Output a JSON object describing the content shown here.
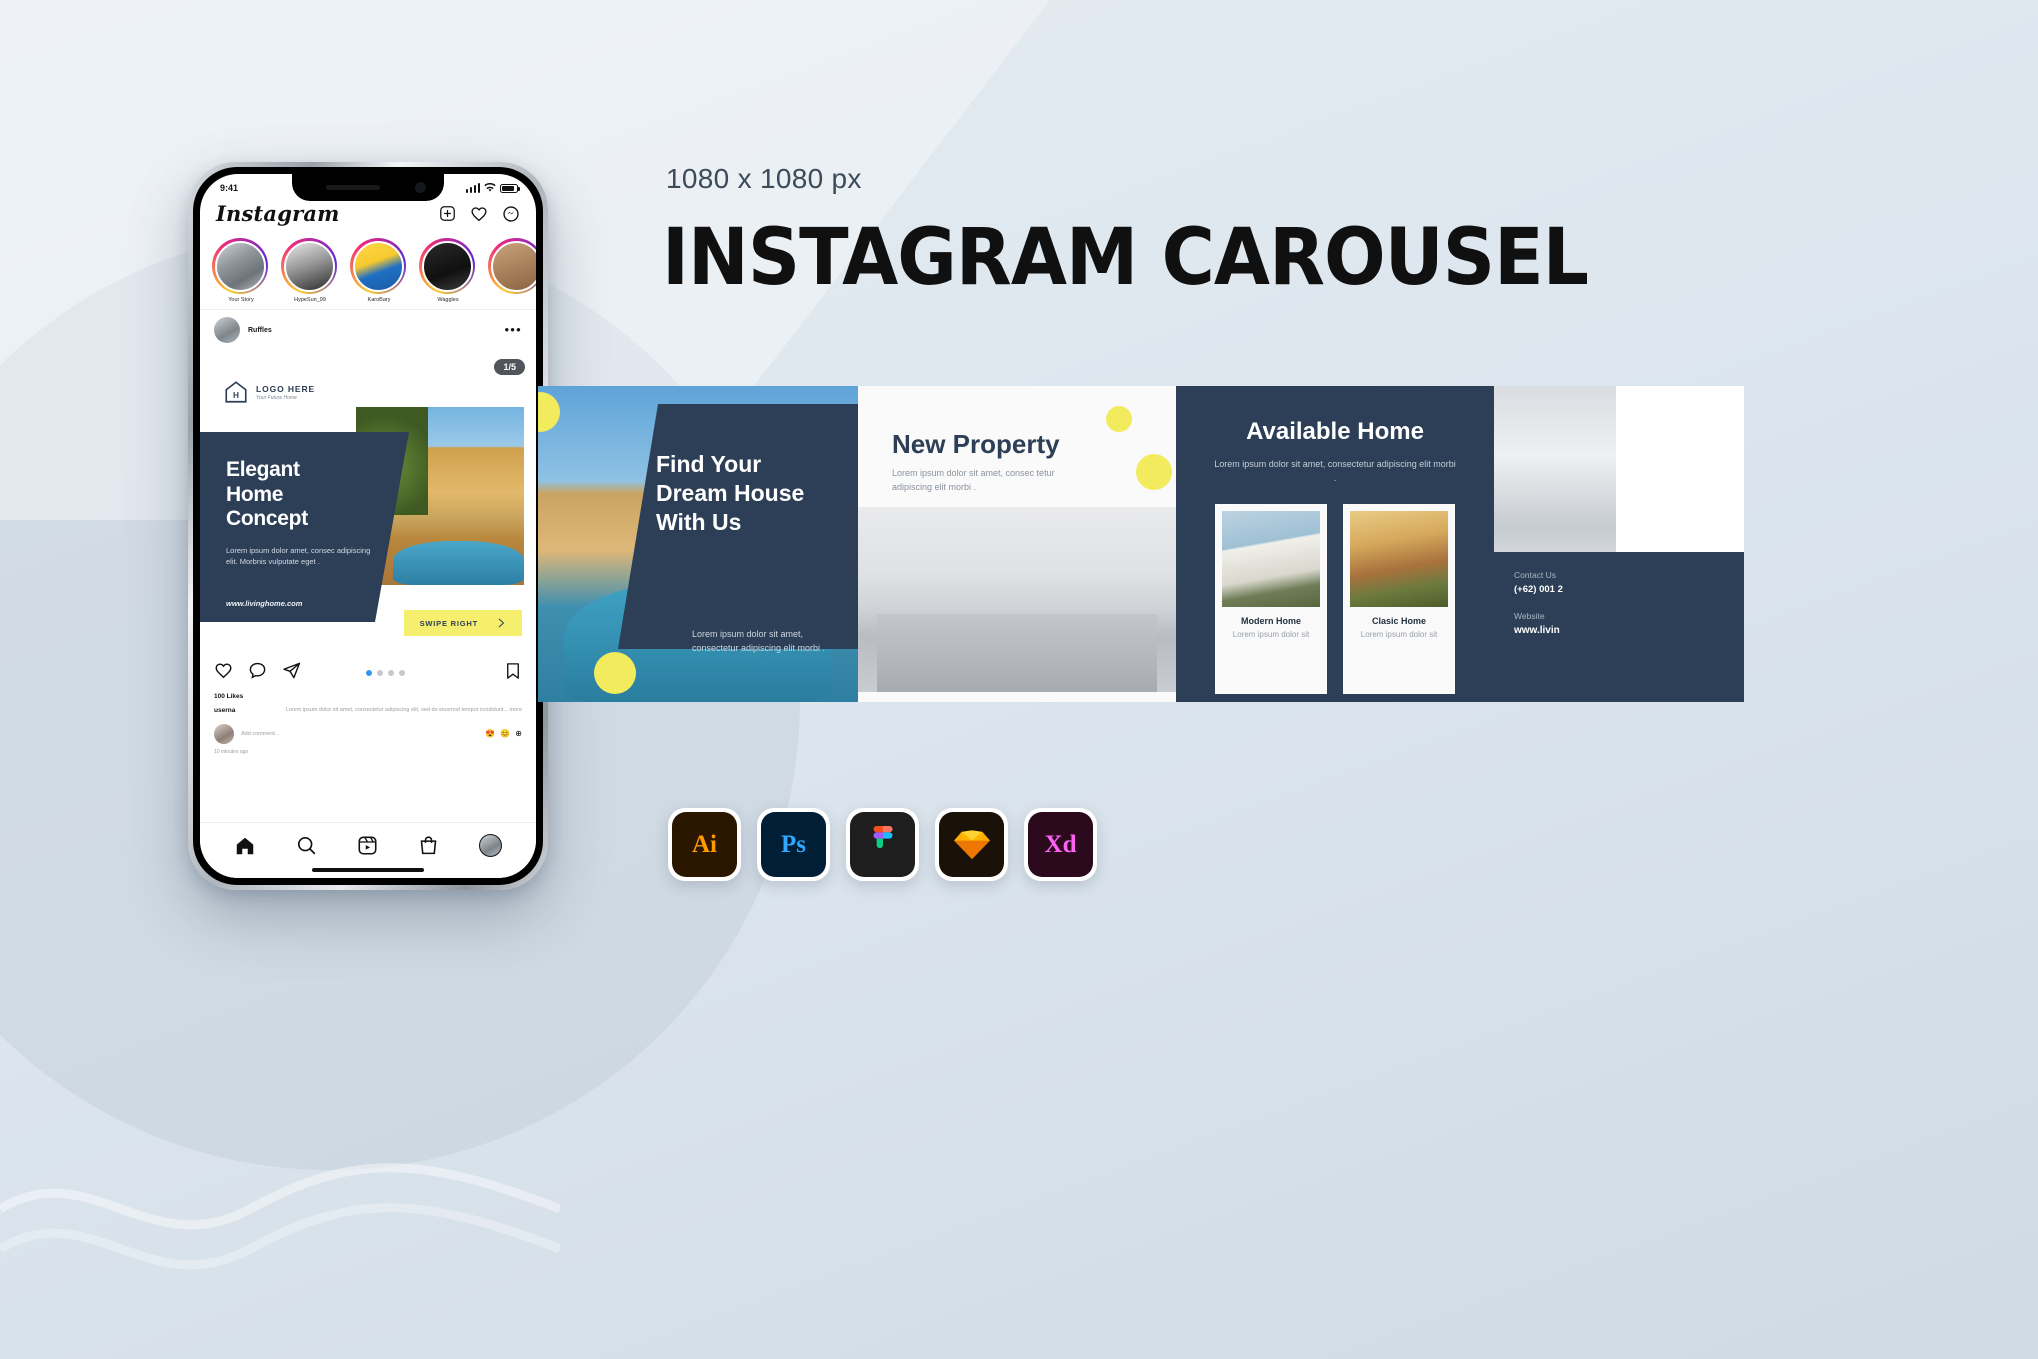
{
  "meta": {
    "dimensions_label": "1080 x 1080 px",
    "main_title": "INSTAGRAM CAROUSEL",
    "accent_navy": "#2c3f56",
    "accent_yellow": "#f3eb5e",
    "background": "#e5ecf2"
  },
  "phone": {
    "status": {
      "time": "9:41"
    },
    "app_name": "Instagram",
    "header_icons": [
      "add-post-icon",
      "heart-icon",
      "messenger-icon"
    ],
    "stories": [
      {
        "name": "Your Story"
      },
      {
        "name": "HypeSun_99"
      },
      {
        "name": "KaroBary"
      },
      {
        "name": "Waggles"
      },
      {
        "name": ""
      }
    ],
    "post": {
      "username": "Ruffles",
      "more_icon": "•••",
      "counter": "1/5",
      "logo_title": "LOGO HERE",
      "logo_sub": "Your Future Home",
      "headline": "Elegant\nHome\nConcept",
      "body": "Lorem ipsum dolor amet, consec adipiscing elit. Morbnis vulputate eget .",
      "url": "www.livinghome.com",
      "swipe_label": "SWIPE RIGHT",
      "likes": "100 Likes",
      "caption_user": "userna",
      "caption_text": "Lorem ipsum dolor sit amet, consectetur adipiscing elit, sed do eiusmod tempor incididunt...",
      "caption_more": " more",
      "add_comment_placeholder": "Add comment...",
      "timestamp": "10 minutes ago",
      "dots_total": 4,
      "dots_active": 1
    },
    "tabs": [
      "home-icon",
      "search-icon",
      "reels-icon",
      "shop-icon",
      "profile-avatar"
    ]
  },
  "carousel": {
    "slide_a": {
      "headline": "Find Your\nDream House\nWith Us",
      "body": "Lorem ipsum dolor sit amet, consectetur adipiscing elit morbi ."
    },
    "slide_b": {
      "headline": "New Property",
      "body": "Lorem ipsum dolor sit amet, consec tetur adipiscing elit morbi ."
    },
    "slide_c": {
      "headline": "Available Home",
      "body": "Lorem ipsum dolor sit amet, consectetur adipiscing elit morbi .",
      "cards": [
        {
          "title": "Modern Home",
          "sub": "Lorem ipsum dolor sit"
        },
        {
          "title": "Clasic Home",
          "sub": "Lorem ipsum dolor sit"
        }
      ]
    },
    "slide_d": {
      "contact_label": "Contact Us",
      "contact_value": "(+62) 001 2",
      "website_label": "Website",
      "website_value": "www.livin"
    }
  },
  "apps": [
    {
      "name": "illustrator",
      "label": "Ai"
    },
    {
      "name": "photoshop",
      "label": "Ps"
    },
    {
      "name": "figma",
      "label": ""
    },
    {
      "name": "sketch",
      "label": ""
    },
    {
      "name": "adobe-xd",
      "label": "Xd"
    }
  ]
}
